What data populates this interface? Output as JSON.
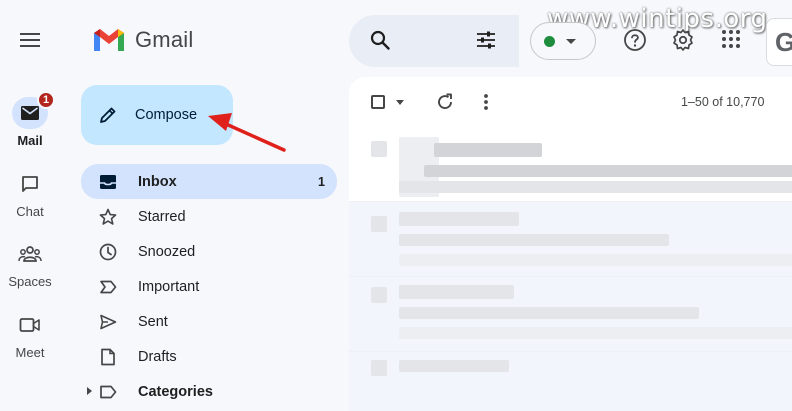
{
  "watermark": "www.wintips.org",
  "app": {
    "logo_text": "Gmail"
  },
  "rail": [
    {
      "label": "Mail",
      "icon": "mail-icon",
      "badge": "1",
      "active": true
    },
    {
      "label": "Chat",
      "icon": "chat-icon"
    },
    {
      "label": "Spaces",
      "icon": "spaces-icon"
    },
    {
      "label": "Meet",
      "icon": "meet-icon"
    }
  ],
  "compose": {
    "label": "Compose"
  },
  "nav": [
    {
      "label": "Inbox",
      "icon": "inbox-icon",
      "count": "1",
      "active": true
    },
    {
      "label": "Starred",
      "icon": "star-icon"
    },
    {
      "label": "Snoozed",
      "icon": "clock-icon"
    },
    {
      "label": "Important",
      "icon": "important-icon"
    },
    {
      "label": "Sent",
      "icon": "send-icon"
    },
    {
      "label": "Drafts",
      "icon": "draft-icon"
    },
    {
      "label": "Categories",
      "icon": "label-icon"
    }
  ],
  "toolbar": {
    "pagination": "1–50 of 10,770"
  },
  "status": {
    "color": "#1e8e3e"
  },
  "account": {
    "initial": "G"
  },
  "colors": {
    "accent": "#c2e7ff",
    "active": "#d3e3fd",
    "annotation": "#e0201b",
    "badge": "#b3261e"
  }
}
